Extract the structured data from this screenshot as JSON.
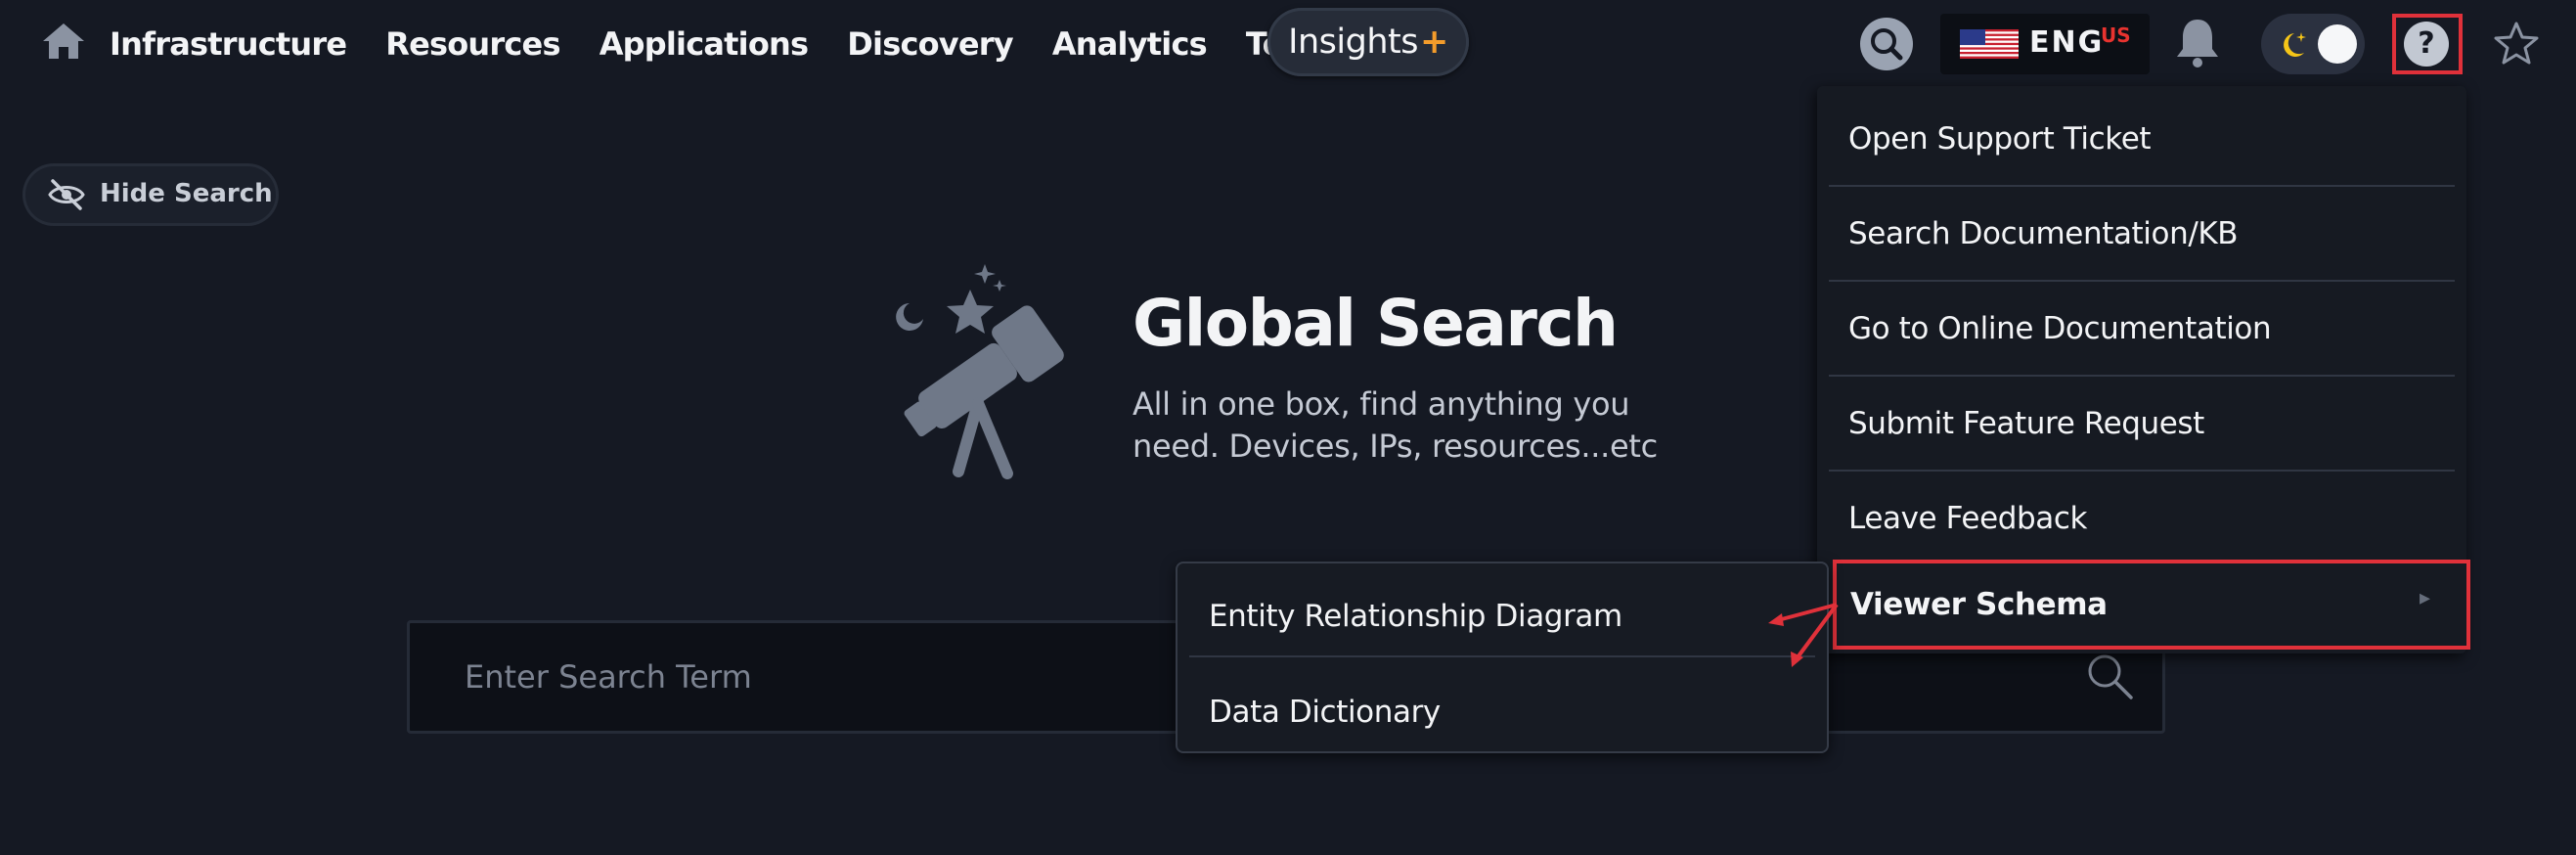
{
  "nav": {
    "links": [
      "Infrastructure",
      "Resources",
      "Applications",
      "Discovery",
      "Analytics",
      "Tools"
    ],
    "insights_label": "Insights",
    "insights_suffix": "+",
    "language_code": "ENG",
    "language_region": "US",
    "help_glyph": "?"
  },
  "hide_search_label": "Hide Search",
  "hero": {
    "title": "Global Search",
    "subtitle": "All in one box, find anything you need. Devices, IPs, resources...etc"
  },
  "search": {
    "placeholder": "Enter Search Term"
  },
  "help_menu": {
    "items": [
      "Open Support Ticket",
      "Search Documentation/KB",
      "Go to Online Documentation",
      "Submit Feature Request",
      "Leave Feedback"
    ],
    "viewer_schema": "Viewer Schema",
    "submenu": [
      "Entity Relationship Diagram",
      "Data Dictionary"
    ]
  },
  "colors": {
    "background": "#151923",
    "highlight": "#e0313a",
    "accent": "#f39c2b"
  },
  "icons": [
    "home-icon",
    "search-icon",
    "us-flag-icon",
    "bell-icon",
    "moon-icon",
    "help-icon",
    "star-icon",
    "eye-off-icon",
    "telescope-icon",
    "chevron-right-icon"
  ]
}
